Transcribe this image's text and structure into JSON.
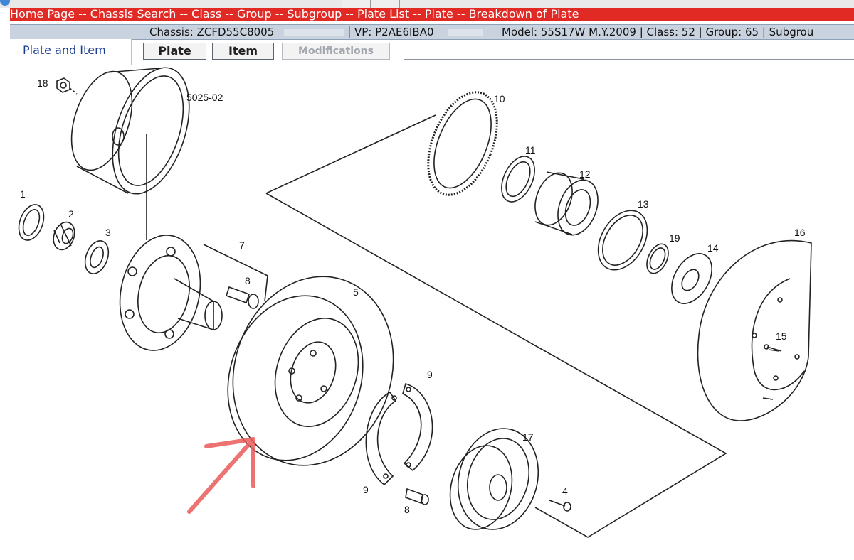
{
  "nav": {
    "items": [
      "Home Page",
      "Chassis Search",
      "Class",
      "Group",
      "Subgroup",
      "Plate List",
      "Plate",
      "Breakdown of Plate"
    ],
    "separator": " -- "
  },
  "info": {
    "chassis": "Chassis: ZCFD55C8005",
    "vp": "VP: P2AE6IBA0",
    "details": "Model: 55S17W M.Y.2009 | Class: 52 | Group: 65 | Subgrou"
  },
  "tabs": {
    "active": "Plate and Item"
  },
  "toolbar": {
    "plate_label": "Plate",
    "item_label": "Item",
    "modifications_label": "Modifications"
  },
  "diagram": {
    "plate_code": "5025-02",
    "callouts": [
      "18",
      "1",
      "2",
      "3",
      "7",
      "8",
      "5",
      "9",
      "9",
      "8",
      "17",
      "4",
      "10",
      "11",
      "12",
      "13",
      "19",
      "14",
      "16",
      "15"
    ],
    "annotation_color": "#ea5a5a"
  }
}
